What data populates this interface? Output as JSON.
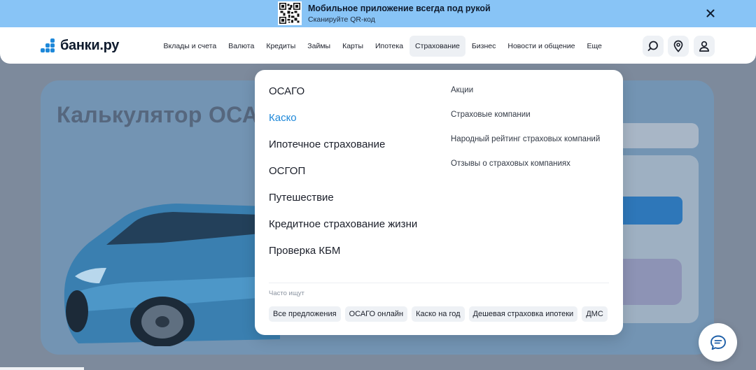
{
  "banner": {
    "title": "Мобильное приложение всегда под рукой",
    "subtitle": "Сканируйте QR-код",
    "icons": {
      "qr": "qr-code-icon",
      "close": "close-icon"
    }
  },
  "header": {
    "logo_text": "банки.ру",
    "nav": [
      {
        "label": "Вклады и счета"
      },
      {
        "label": "Валюта"
      },
      {
        "label": "Кредиты"
      },
      {
        "label": "Займы"
      },
      {
        "label": "Карты"
      },
      {
        "label": "Ипотека"
      },
      {
        "label": "Страхование",
        "active": true
      },
      {
        "label": "Бизнес"
      },
      {
        "label": "Новости и общение"
      },
      {
        "label": "Еще"
      }
    ],
    "icons": {
      "search": "search-icon",
      "location": "location-pin-icon",
      "profile": "user-icon"
    }
  },
  "background": {
    "calc_title": "Калькулятор ОСА"
  },
  "dropdown": {
    "main_links": [
      {
        "label": "ОСАГО"
      },
      {
        "label": "Каско",
        "highlighted": true
      },
      {
        "label": "Ипотечное страхование"
      },
      {
        "label": "ОСГОП"
      },
      {
        "label": "Путешествие"
      },
      {
        "label": "Кредитное страхование жизни"
      },
      {
        "label": "Проверка КБМ"
      }
    ],
    "side_links": [
      {
        "label": "Акции"
      },
      {
        "label": "Страховые компании"
      },
      {
        "label": "Народный рейтинг страховых компаний"
      },
      {
        "label": "Отзывы о страховых компаниях"
      }
    ],
    "frequent_label": "Часто ищут",
    "tags": [
      {
        "label": "Все предложения"
      },
      {
        "label": "ОСАГО онлайн"
      },
      {
        "label": "Каско на год"
      },
      {
        "label": "Дешевая страховка ипотеки"
      },
      {
        "label": "ДМС"
      }
    ]
  },
  "chat": {
    "icon": "chat-bubble-icon"
  },
  "colors": {
    "banner_bg": "#88c4f6",
    "accent": "#1e88d9",
    "overlay": "#7d8a9c"
  }
}
